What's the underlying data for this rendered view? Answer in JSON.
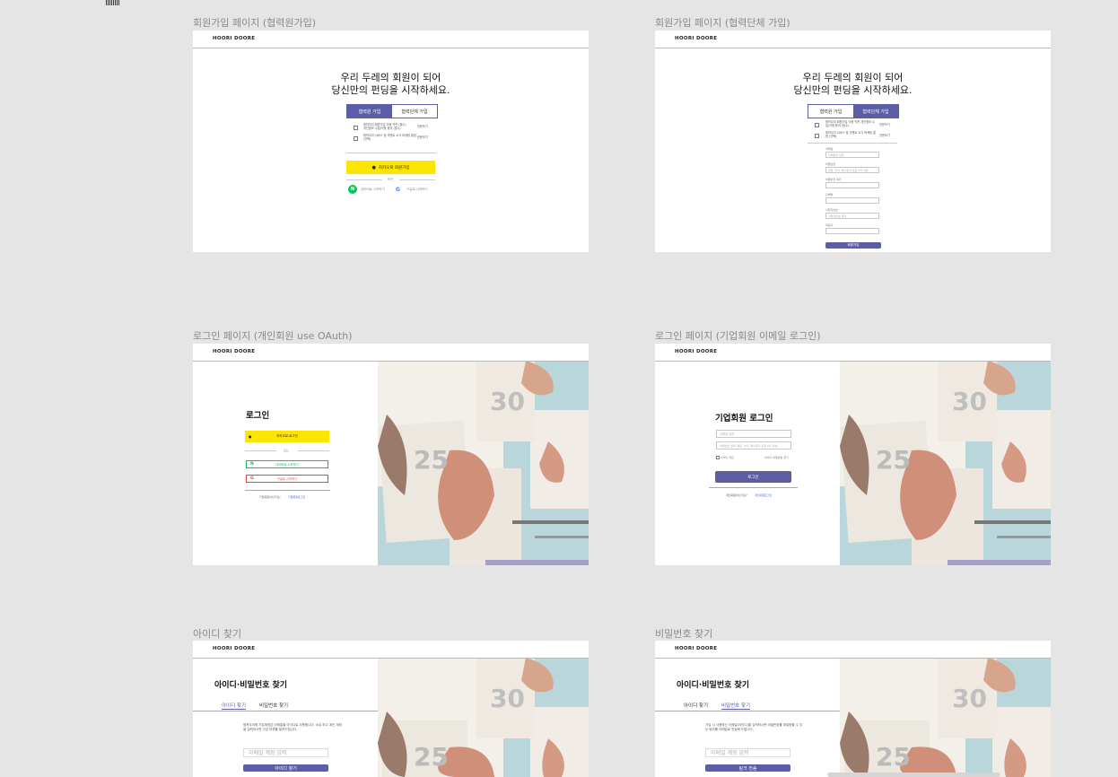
{
  "frames": {
    "f1": {
      "label": "회원가입 페이지 (협력원가입)",
      "logo": "HOORI DOORE",
      "headline1": "우리 두레의 회원이 되어",
      "headline2": "당신만의 펀딩을 시작하세요.",
      "tab_active": "협력원 가입",
      "tab_inactive": "협력단체 가입",
      "agree1": "뭉쳐우리 회원가입 이용 약관 (필수)",
      "agree1_sub": "개인정보 수집/이용 동의 (필수)",
      "agree1_link": "전문보기",
      "agree2": "뭉쳐우리 서비스 및 이벤트 소식 마케팅 알림 (선택)",
      "agree2_link": "전문보기",
      "kakao_label": "카카오로 회원가입",
      "or": "또는",
      "naver_label": "네이버로 시작하기",
      "google_label": "구글로 시작하기"
    },
    "f2": {
      "label": "회원가입 페이지 (협력단체 가입)",
      "logo": "HOORI DOORE",
      "headline1": "우리 두레의 회원이 되어",
      "headline2": "당신만의 펀딩을 시작하세요.",
      "tab_inactive": "협력원 가입",
      "tab_active": "협력단체 가입",
      "agree1": "뭉쳐우리 회원가입 이용 약관 개인정보 수집/이용 동의 (필수)",
      "agree1_link": "전문보기",
      "agree2": "뭉쳐우리 서비스 및 이벤트 소식 마케팅 알림 (선택)",
      "agree2_link": "전문보기",
      "fields": [
        {
          "label": "이메일",
          "placeholder": "이메일을 입력"
        },
        {
          "label": "비밀번호",
          "placeholder": "영문, 숫자, 특수문자 포함 8자 이상"
        },
        {
          "label": "비밀번호 확인",
          "placeholder": ""
        },
        {
          "label": "단체명",
          "placeholder": ""
        },
        {
          "label": "사업자번호",
          "placeholder": "사업자번호 입력"
        },
        {
          "label": "대표자",
          "placeholder": ""
        }
      ],
      "submit": "회원가입"
    },
    "f3": {
      "label": "로그인 페이지 (개인회원 use OAuth)",
      "logo": "HOORI DOORE",
      "title": "로그인",
      "kakao_label": "카카오로 로그인",
      "or": "또는",
      "naver_label": "네이버로 시작하기",
      "google_label": "구글로 시작하기",
      "corp_question": "기업회원이신가요?",
      "corp_link": "기업회원로그인"
    },
    "f4": {
      "label": "로그인 페이지 (기업회원 이메일 로그인)",
      "logo": "HOORI DOORE",
      "title": "기업회원 로그인",
      "email_placeholder": "이메일 입력",
      "password_placeholder": "비밀번호 입력 (영문, 숫자, 특수문자 포함 8자 이상)",
      "remember": "아이디 저장",
      "find": "아이디·비밀번호 찾기",
      "login_btn": "로그인",
      "personal_question": "개인회원이신가요?",
      "personal_link": "개인회원로그인"
    },
    "f5": {
      "label": "아이디 찾기",
      "logo": "HOORI DOORE",
      "title": "아이디·비밀번호 찾기",
      "tab_id": "아이디 찾기",
      "tab_pw": "비밀번호 찾기",
      "desc": "뭉쳐우리에 기업계정은 이메일을 아이디로 사용합니다. 소유 하고 계신 계정을 입력하시면 가입 여부를 알려드립니다.",
      "input_placeholder": "이메일 계정 입력",
      "btn": "아이디 찾기"
    },
    "f6": {
      "label": "비밀번호 찾기",
      "logo": "HOORI DOORE",
      "title": "아이디·비밀번호 찾기",
      "tab_id": "아이디 찾기",
      "tab_pw": "비밀번호 찾기",
      "desc": "가입 시 사용하신 이메일(아이디)을 입력하시면 비밀번호를 재설정할 수 있는 링크를 이메일로 전송해 드립니다.",
      "input_placeholder": "이메일 계정 입력",
      "btn": "링크 전송"
    }
  },
  "colors": {
    "brand_purple": "#5b5ea6",
    "kakao_yellow": "#fee500",
    "naver_green": "#03c75a",
    "google_red": "#ea4335",
    "canvas": "#e5e5e5"
  },
  "photo_numbers": {
    "top": "30",
    "bottom": "25"
  }
}
